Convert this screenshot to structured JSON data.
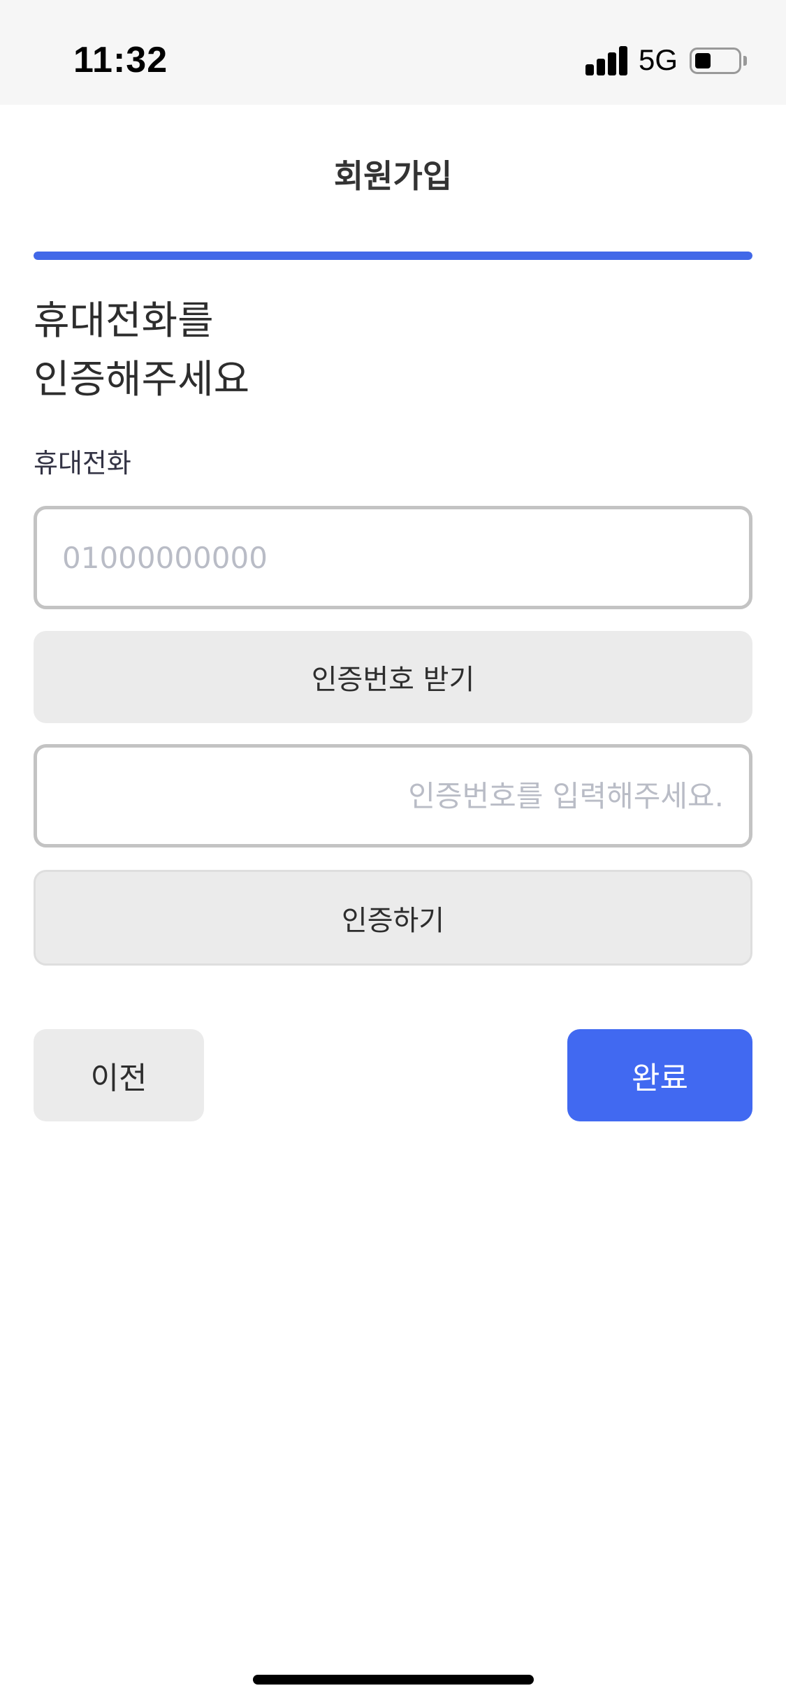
{
  "status_bar": {
    "time": "11:32",
    "network": "5G",
    "icons": [
      "signal-icon",
      "battery-icon"
    ]
  },
  "header": {
    "title": "회원가입"
  },
  "progress": {
    "value": 1.0,
    "color": "#4168e8"
  },
  "heading": {
    "line1": "휴대전화를",
    "line2": "인증해주세요"
  },
  "phone": {
    "label": "휴대전화",
    "placeholder": "01000000000",
    "value": ""
  },
  "request_code_button": "인증번호 받기",
  "code": {
    "placeholder": "인증번호를 입력해주세요.",
    "value": ""
  },
  "verify_button": "인증하기",
  "footer": {
    "prev_label": "이전",
    "done_label": "완료"
  },
  "colors": {
    "accent": "#4169f1",
    "button_gray": "#ebebeb",
    "input_border": "#c3c3c3"
  }
}
